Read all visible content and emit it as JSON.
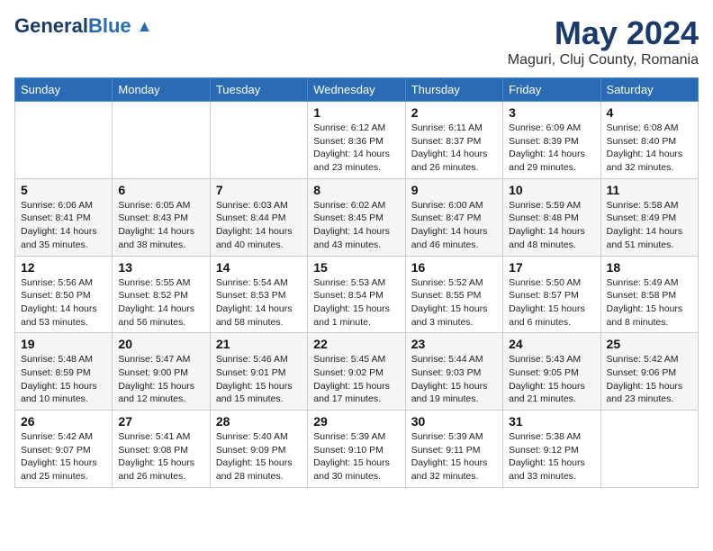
{
  "header": {
    "logo_general": "General",
    "logo_blue": "Blue",
    "month": "May 2024",
    "location": "Maguri, Cluj County, Romania"
  },
  "weekdays": [
    "Sunday",
    "Monday",
    "Tuesday",
    "Wednesday",
    "Thursday",
    "Friday",
    "Saturday"
  ],
  "weeks": [
    [
      {
        "day": "",
        "info": ""
      },
      {
        "day": "",
        "info": ""
      },
      {
        "day": "",
        "info": ""
      },
      {
        "day": "1",
        "info": "Sunrise: 6:12 AM\nSunset: 8:36 PM\nDaylight: 14 hours\nand 23 minutes."
      },
      {
        "day": "2",
        "info": "Sunrise: 6:11 AM\nSunset: 8:37 PM\nDaylight: 14 hours\nand 26 minutes."
      },
      {
        "day": "3",
        "info": "Sunrise: 6:09 AM\nSunset: 8:39 PM\nDaylight: 14 hours\nand 29 minutes."
      },
      {
        "day": "4",
        "info": "Sunrise: 6:08 AM\nSunset: 8:40 PM\nDaylight: 14 hours\nand 32 minutes."
      }
    ],
    [
      {
        "day": "5",
        "info": "Sunrise: 6:06 AM\nSunset: 8:41 PM\nDaylight: 14 hours\nand 35 minutes."
      },
      {
        "day": "6",
        "info": "Sunrise: 6:05 AM\nSunset: 8:43 PM\nDaylight: 14 hours\nand 38 minutes."
      },
      {
        "day": "7",
        "info": "Sunrise: 6:03 AM\nSunset: 8:44 PM\nDaylight: 14 hours\nand 40 minutes."
      },
      {
        "day": "8",
        "info": "Sunrise: 6:02 AM\nSunset: 8:45 PM\nDaylight: 14 hours\nand 43 minutes."
      },
      {
        "day": "9",
        "info": "Sunrise: 6:00 AM\nSunset: 8:47 PM\nDaylight: 14 hours\nand 46 minutes."
      },
      {
        "day": "10",
        "info": "Sunrise: 5:59 AM\nSunset: 8:48 PM\nDaylight: 14 hours\nand 48 minutes."
      },
      {
        "day": "11",
        "info": "Sunrise: 5:58 AM\nSunset: 8:49 PM\nDaylight: 14 hours\nand 51 minutes."
      }
    ],
    [
      {
        "day": "12",
        "info": "Sunrise: 5:56 AM\nSunset: 8:50 PM\nDaylight: 14 hours\nand 53 minutes."
      },
      {
        "day": "13",
        "info": "Sunrise: 5:55 AM\nSunset: 8:52 PM\nDaylight: 14 hours\nand 56 minutes."
      },
      {
        "day": "14",
        "info": "Sunrise: 5:54 AM\nSunset: 8:53 PM\nDaylight: 14 hours\nand 58 minutes."
      },
      {
        "day": "15",
        "info": "Sunrise: 5:53 AM\nSunset: 8:54 PM\nDaylight: 15 hours\nand 1 minute."
      },
      {
        "day": "16",
        "info": "Sunrise: 5:52 AM\nSunset: 8:55 PM\nDaylight: 15 hours\nand 3 minutes."
      },
      {
        "day": "17",
        "info": "Sunrise: 5:50 AM\nSunset: 8:57 PM\nDaylight: 15 hours\nand 6 minutes."
      },
      {
        "day": "18",
        "info": "Sunrise: 5:49 AM\nSunset: 8:58 PM\nDaylight: 15 hours\nand 8 minutes."
      }
    ],
    [
      {
        "day": "19",
        "info": "Sunrise: 5:48 AM\nSunset: 8:59 PM\nDaylight: 15 hours\nand 10 minutes."
      },
      {
        "day": "20",
        "info": "Sunrise: 5:47 AM\nSunset: 9:00 PM\nDaylight: 15 hours\nand 12 minutes."
      },
      {
        "day": "21",
        "info": "Sunrise: 5:46 AM\nSunset: 9:01 PM\nDaylight: 15 hours\nand 15 minutes."
      },
      {
        "day": "22",
        "info": "Sunrise: 5:45 AM\nSunset: 9:02 PM\nDaylight: 15 hours\nand 17 minutes."
      },
      {
        "day": "23",
        "info": "Sunrise: 5:44 AM\nSunset: 9:03 PM\nDaylight: 15 hours\nand 19 minutes."
      },
      {
        "day": "24",
        "info": "Sunrise: 5:43 AM\nSunset: 9:05 PM\nDaylight: 15 hours\nand 21 minutes."
      },
      {
        "day": "25",
        "info": "Sunrise: 5:42 AM\nSunset: 9:06 PM\nDaylight: 15 hours\nand 23 minutes."
      }
    ],
    [
      {
        "day": "26",
        "info": "Sunrise: 5:42 AM\nSunset: 9:07 PM\nDaylight: 15 hours\nand 25 minutes."
      },
      {
        "day": "27",
        "info": "Sunrise: 5:41 AM\nSunset: 9:08 PM\nDaylight: 15 hours\nand 26 minutes."
      },
      {
        "day": "28",
        "info": "Sunrise: 5:40 AM\nSunset: 9:09 PM\nDaylight: 15 hours\nand 28 minutes."
      },
      {
        "day": "29",
        "info": "Sunrise: 5:39 AM\nSunset: 9:10 PM\nDaylight: 15 hours\nand 30 minutes."
      },
      {
        "day": "30",
        "info": "Sunrise: 5:39 AM\nSunset: 9:11 PM\nDaylight: 15 hours\nand 32 minutes."
      },
      {
        "day": "31",
        "info": "Sunrise: 5:38 AM\nSunset: 9:12 PM\nDaylight: 15 hours\nand 33 minutes."
      },
      {
        "day": "",
        "info": ""
      }
    ]
  ]
}
